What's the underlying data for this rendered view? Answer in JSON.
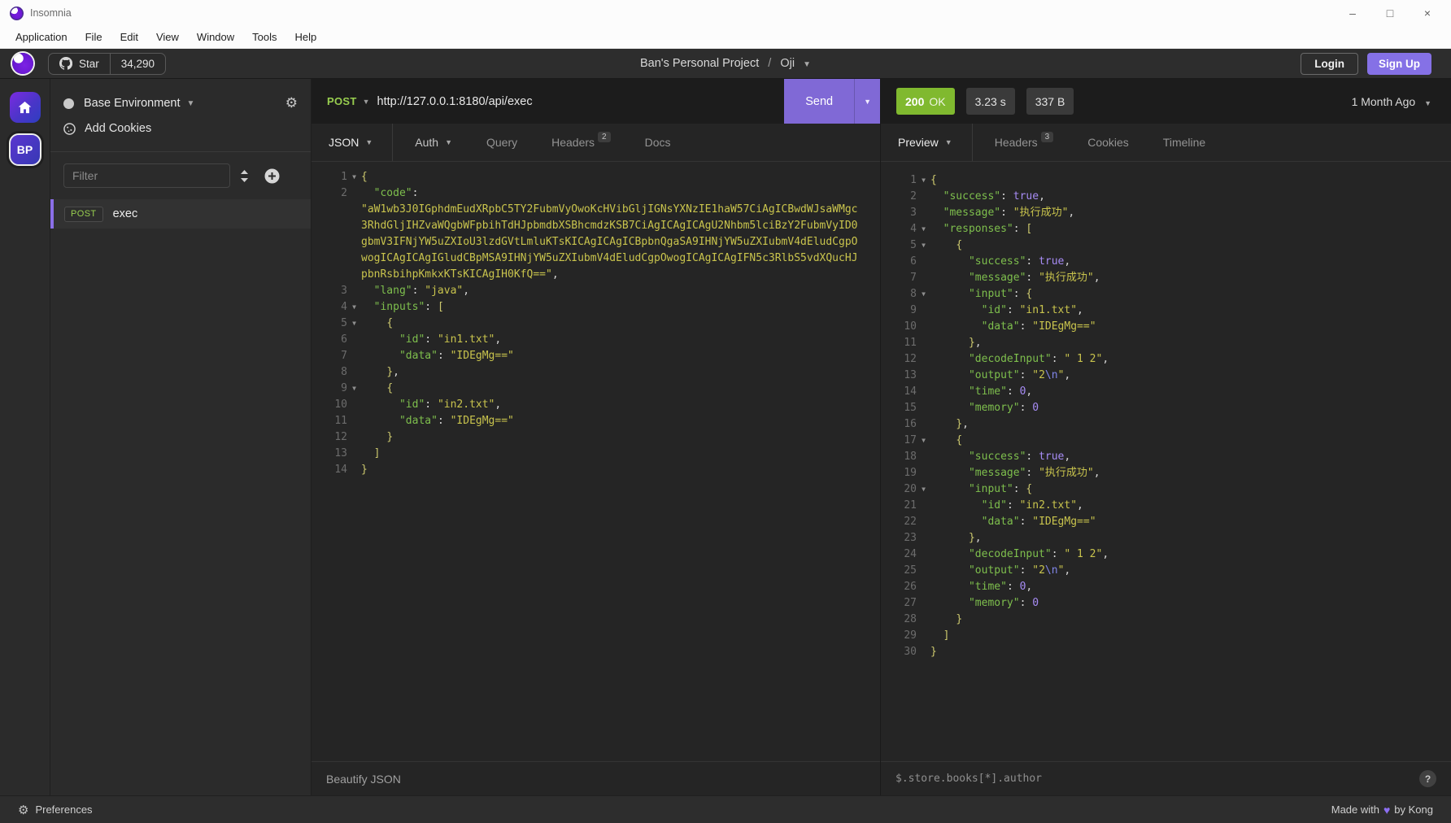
{
  "window": {
    "title": "Insomnia",
    "controls": {
      "minimize": "–",
      "maximize": "□",
      "close": "×"
    }
  },
  "menu": {
    "items": [
      "Application",
      "File",
      "Edit",
      "View",
      "Window",
      "Tools",
      "Help"
    ]
  },
  "header": {
    "star_label": "Star",
    "star_count": "34,290",
    "project": "Ban's Personal Project",
    "separator": "/",
    "workspace": "Oji",
    "login_label": "Login",
    "signup_label": "Sign Up"
  },
  "rail": {
    "avatar_initials": "BP"
  },
  "sidebar": {
    "environment_label": "Base Environment",
    "add_cookies_label": "Add Cookies",
    "filter_placeholder": "Filter",
    "request": {
      "method": "POST",
      "name": "exec"
    }
  },
  "request_panel": {
    "method": "POST",
    "url": "http://127.0.0.1:8180/api/exec",
    "send_label": "Send",
    "tabs": {
      "body_tab": "JSON",
      "auth_tab": "Auth",
      "query_tab": "Query",
      "headers_tab": "Headers",
      "headers_count": "2",
      "docs_tab": "Docs"
    },
    "beautify_label": "Beautify JSON",
    "editor_lines": [
      {
        "n": 1,
        "fold": true,
        "tokens": [
          [
            "brace",
            "{"
          ]
        ]
      },
      {
        "n": 2,
        "tokens": [
          [
            "ws",
            "  "
          ],
          [
            "key",
            "\"code\""
          ],
          [
            "pun",
            ":"
          ],
          [
            "br",
            ""
          ],
          [
            "str",
            "\"aW1wb3J0IGphdmEudXRpbC5TY2FubmVyOwoKcHVibGljIGNsYXNzIE1haW57CiAgICBwdWJsaWMgc3RhdGljIHZvaWQgbWFpbihTdHJpbmdbXSBhcmdzKSB7CiAgICAgICAgU2Nhbm5lciBzY2FubmVyID0gbmV3IFNjYW5uZXIoU3lzdGVtLmluKTsKICAgICAgICBpbnQgaSA9IHNjYW5uZXIubmV4dEludCgpOwogICAgICAgIGludCBpMSA9IHNjYW5uZXIubmV4dEludCgpOwogICAgICAgIFN5c3RlbS5vdXQucHJpbnRsbihpKmkxKTsKICAgIH0KfQ==\""
          ],
          [
            "pun",
            ","
          ]
        ]
      },
      {
        "n": 3,
        "tokens": [
          [
            "ws",
            "  "
          ],
          [
            "key",
            "\"lang\""
          ],
          [
            "pun",
            ": "
          ],
          [
            "str",
            "\"java\""
          ],
          [
            "pun",
            ","
          ]
        ]
      },
      {
        "n": 4,
        "fold": true,
        "tokens": [
          [
            "ws",
            "  "
          ],
          [
            "key",
            "\"inputs\""
          ],
          [
            "pun",
            ": "
          ],
          [
            "brace",
            "["
          ]
        ]
      },
      {
        "n": 5,
        "fold": true,
        "tokens": [
          [
            "ws",
            "    "
          ],
          [
            "brace",
            "{"
          ]
        ]
      },
      {
        "n": 6,
        "tokens": [
          [
            "ws",
            "      "
          ],
          [
            "key",
            "\"id\""
          ],
          [
            "pun",
            ": "
          ],
          [
            "str",
            "\"in1.txt\""
          ],
          [
            "pun",
            ","
          ]
        ]
      },
      {
        "n": 7,
        "tokens": [
          [
            "ws",
            "      "
          ],
          [
            "key",
            "\"data\""
          ],
          [
            "pun",
            ": "
          ],
          [
            "str",
            "\"IDEgMg==\""
          ]
        ]
      },
      {
        "n": 8,
        "tokens": [
          [
            "ws",
            "    "
          ],
          [
            "brace",
            "}"
          ],
          [
            "pun",
            ","
          ]
        ]
      },
      {
        "n": 9,
        "fold": true,
        "tokens": [
          [
            "ws",
            "    "
          ],
          [
            "brace",
            "{"
          ]
        ]
      },
      {
        "n": 10,
        "tokens": [
          [
            "ws",
            "      "
          ],
          [
            "key",
            "\"id\""
          ],
          [
            "pun",
            ": "
          ],
          [
            "str",
            "\"in2.txt\""
          ],
          [
            "pun",
            ","
          ]
        ]
      },
      {
        "n": 11,
        "tokens": [
          [
            "ws",
            "      "
          ],
          [
            "key",
            "\"data\""
          ],
          [
            "pun",
            ": "
          ],
          [
            "str",
            "\"IDEgMg==\""
          ]
        ]
      },
      {
        "n": 12,
        "tokens": [
          [
            "ws",
            "    "
          ],
          [
            "brace",
            "}"
          ]
        ]
      },
      {
        "n": 13,
        "tokens": [
          [
            "ws",
            "  "
          ],
          [
            "brace",
            "]"
          ]
        ]
      },
      {
        "n": 14,
        "tokens": [
          [
            "brace",
            "}"
          ]
        ]
      }
    ]
  },
  "response_panel": {
    "status_code": "200",
    "status_text": "OK",
    "time": "3.23 s",
    "size": "337 B",
    "time_ago": "1 Month Ago",
    "tabs": {
      "preview_tab": "Preview",
      "headers_tab": "Headers",
      "headers_count": "3",
      "cookies_tab": "Cookies",
      "timeline_tab": "Timeline"
    },
    "filter_placeholder": "$.store.books[*].author",
    "editor_lines": [
      {
        "n": 1,
        "fold": true,
        "tokens": [
          [
            "brace",
            "{"
          ]
        ]
      },
      {
        "n": 2,
        "tokens": [
          [
            "ws",
            "  "
          ],
          [
            "key",
            "\"success\""
          ],
          [
            "pun",
            ": "
          ],
          [
            "bool",
            "true"
          ],
          [
            "pun",
            ","
          ]
        ]
      },
      {
        "n": 3,
        "tokens": [
          [
            "ws",
            "  "
          ],
          [
            "key",
            "\"message\""
          ],
          [
            "pun",
            ": "
          ],
          [
            "str",
            "\"执行成功\""
          ],
          [
            "pun",
            ","
          ]
        ]
      },
      {
        "n": 4,
        "fold": true,
        "tokens": [
          [
            "ws",
            "  "
          ],
          [
            "key",
            "\"responses\""
          ],
          [
            "pun",
            ": "
          ],
          [
            "brace",
            "["
          ]
        ]
      },
      {
        "n": 5,
        "fold": true,
        "tokens": [
          [
            "ws",
            "    "
          ],
          [
            "brace",
            "{"
          ]
        ]
      },
      {
        "n": 6,
        "tokens": [
          [
            "ws",
            "      "
          ],
          [
            "key",
            "\"success\""
          ],
          [
            "pun",
            ": "
          ],
          [
            "bool",
            "true"
          ],
          [
            "pun",
            ","
          ]
        ]
      },
      {
        "n": 7,
        "tokens": [
          [
            "ws",
            "      "
          ],
          [
            "key",
            "\"message\""
          ],
          [
            "pun",
            ": "
          ],
          [
            "str",
            "\"执行成功\""
          ],
          [
            "pun",
            ","
          ]
        ]
      },
      {
        "n": 8,
        "fold": true,
        "tokens": [
          [
            "ws",
            "      "
          ],
          [
            "key",
            "\"input\""
          ],
          [
            "pun",
            ": "
          ],
          [
            "brace",
            "{"
          ]
        ]
      },
      {
        "n": 9,
        "tokens": [
          [
            "ws",
            "        "
          ],
          [
            "key",
            "\"id\""
          ],
          [
            "pun",
            ": "
          ],
          [
            "str",
            "\"in1.txt\""
          ],
          [
            "pun",
            ","
          ]
        ]
      },
      {
        "n": 10,
        "tokens": [
          [
            "ws",
            "        "
          ],
          [
            "key",
            "\"data\""
          ],
          [
            "pun",
            ": "
          ],
          [
            "str",
            "\"IDEgMg==\""
          ]
        ]
      },
      {
        "n": 11,
        "tokens": [
          [
            "ws",
            "      "
          ],
          [
            "brace",
            "}"
          ],
          [
            "pun",
            ","
          ]
        ]
      },
      {
        "n": 12,
        "tokens": [
          [
            "ws",
            "      "
          ],
          [
            "key",
            "\"decodeInput\""
          ],
          [
            "pun",
            ": "
          ],
          [
            "str",
            "\" 1 2\""
          ],
          [
            "pun",
            ","
          ]
        ]
      },
      {
        "n": 13,
        "tokens": [
          [
            "ws",
            "      "
          ],
          [
            "key",
            "\"output\""
          ],
          [
            "pun",
            ": "
          ],
          [
            "str",
            "\"2"
          ],
          [
            "esc",
            "\\n"
          ],
          [
            "str",
            "\""
          ],
          [
            "pun",
            ","
          ]
        ]
      },
      {
        "n": 14,
        "tokens": [
          [
            "ws",
            "      "
          ],
          [
            "key",
            "\"time\""
          ],
          [
            "pun",
            ": "
          ],
          [
            "num",
            "0"
          ],
          [
            "pun",
            ","
          ]
        ]
      },
      {
        "n": 15,
        "tokens": [
          [
            "ws",
            "      "
          ],
          [
            "key",
            "\"memory\""
          ],
          [
            "pun",
            ": "
          ],
          [
            "num",
            "0"
          ]
        ]
      },
      {
        "n": 16,
        "tokens": [
          [
            "ws",
            "    "
          ],
          [
            "brace",
            "}"
          ],
          [
            "pun",
            ","
          ]
        ]
      },
      {
        "n": 17,
        "fold": true,
        "tokens": [
          [
            "ws",
            "    "
          ],
          [
            "brace",
            "{"
          ]
        ]
      },
      {
        "n": 18,
        "tokens": [
          [
            "ws",
            "      "
          ],
          [
            "key",
            "\"success\""
          ],
          [
            "pun",
            ": "
          ],
          [
            "bool",
            "true"
          ],
          [
            "pun",
            ","
          ]
        ]
      },
      {
        "n": 19,
        "tokens": [
          [
            "ws",
            "      "
          ],
          [
            "key",
            "\"message\""
          ],
          [
            "pun",
            ": "
          ],
          [
            "str",
            "\"执行成功\""
          ],
          [
            "pun",
            ","
          ]
        ]
      },
      {
        "n": 20,
        "fold": true,
        "tokens": [
          [
            "ws",
            "      "
          ],
          [
            "key",
            "\"input\""
          ],
          [
            "pun",
            ": "
          ],
          [
            "brace",
            "{"
          ]
        ]
      },
      {
        "n": 21,
        "tokens": [
          [
            "ws",
            "        "
          ],
          [
            "key",
            "\"id\""
          ],
          [
            "pun",
            ": "
          ],
          [
            "str",
            "\"in2.txt\""
          ],
          [
            "pun",
            ","
          ]
        ]
      },
      {
        "n": 22,
        "tokens": [
          [
            "ws",
            "        "
          ],
          [
            "key",
            "\"data\""
          ],
          [
            "pun",
            ": "
          ],
          [
            "str",
            "\"IDEgMg==\""
          ]
        ]
      },
      {
        "n": 23,
        "tokens": [
          [
            "ws",
            "      "
          ],
          [
            "brace",
            "}"
          ],
          [
            "pun",
            ","
          ]
        ]
      },
      {
        "n": 24,
        "tokens": [
          [
            "ws",
            "      "
          ],
          [
            "key",
            "\"decodeInput\""
          ],
          [
            "pun",
            ": "
          ],
          [
            "str",
            "\" 1 2\""
          ],
          [
            "pun",
            ","
          ]
        ]
      },
      {
        "n": 25,
        "tokens": [
          [
            "ws",
            "      "
          ],
          [
            "key",
            "\"output\""
          ],
          [
            "pun",
            ": "
          ],
          [
            "str",
            "\"2"
          ],
          [
            "esc",
            "\\n"
          ],
          [
            "str",
            "\""
          ],
          [
            "pun",
            ","
          ]
        ]
      },
      {
        "n": 26,
        "tokens": [
          [
            "ws",
            "      "
          ],
          [
            "key",
            "\"time\""
          ],
          [
            "pun",
            ": "
          ],
          [
            "num",
            "0"
          ],
          [
            "pun",
            ","
          ]
        ]
      },
      {
        "n": 27,
        "tokens": [
          [
            "ws",
            "      "
          ],
          [
            "key",
            "\"memory\""
          ],
          [
            "pun",
            ": "
          ],
          [
            "num",
            "0"
          ]
        ]
      },
      {
        "n": 28,
        "tokens": [
          [
            "ws",
            "    "
          ],
          [
            "brace",
            "}"
          ]
        ]
      },
      {
        "n": 29,
        "tokens": [
          [
            "ws",
            "  "
          ],
          [
            "brace",
            "]"
          ]
        ]
      },
      {
        "n": 30,
        "tokens": [
          [
            "brace",
            "}"
          ]
        ]
      }
    ]
  },
  "statusbar": {
    "preferences_label": "Preferences",
    "made_with": "Made with",
    "by": "by Kong"
  },
  "colors": {
    "accent_purple": "#8069d6",
    "method_green": "#98ce4f",
    "status_green": "#80b92f",
    "json_key": "#7ebf4d",
    "json_string": "#c9c44d",
    "json_number": "#a78cf5"
  }
}
